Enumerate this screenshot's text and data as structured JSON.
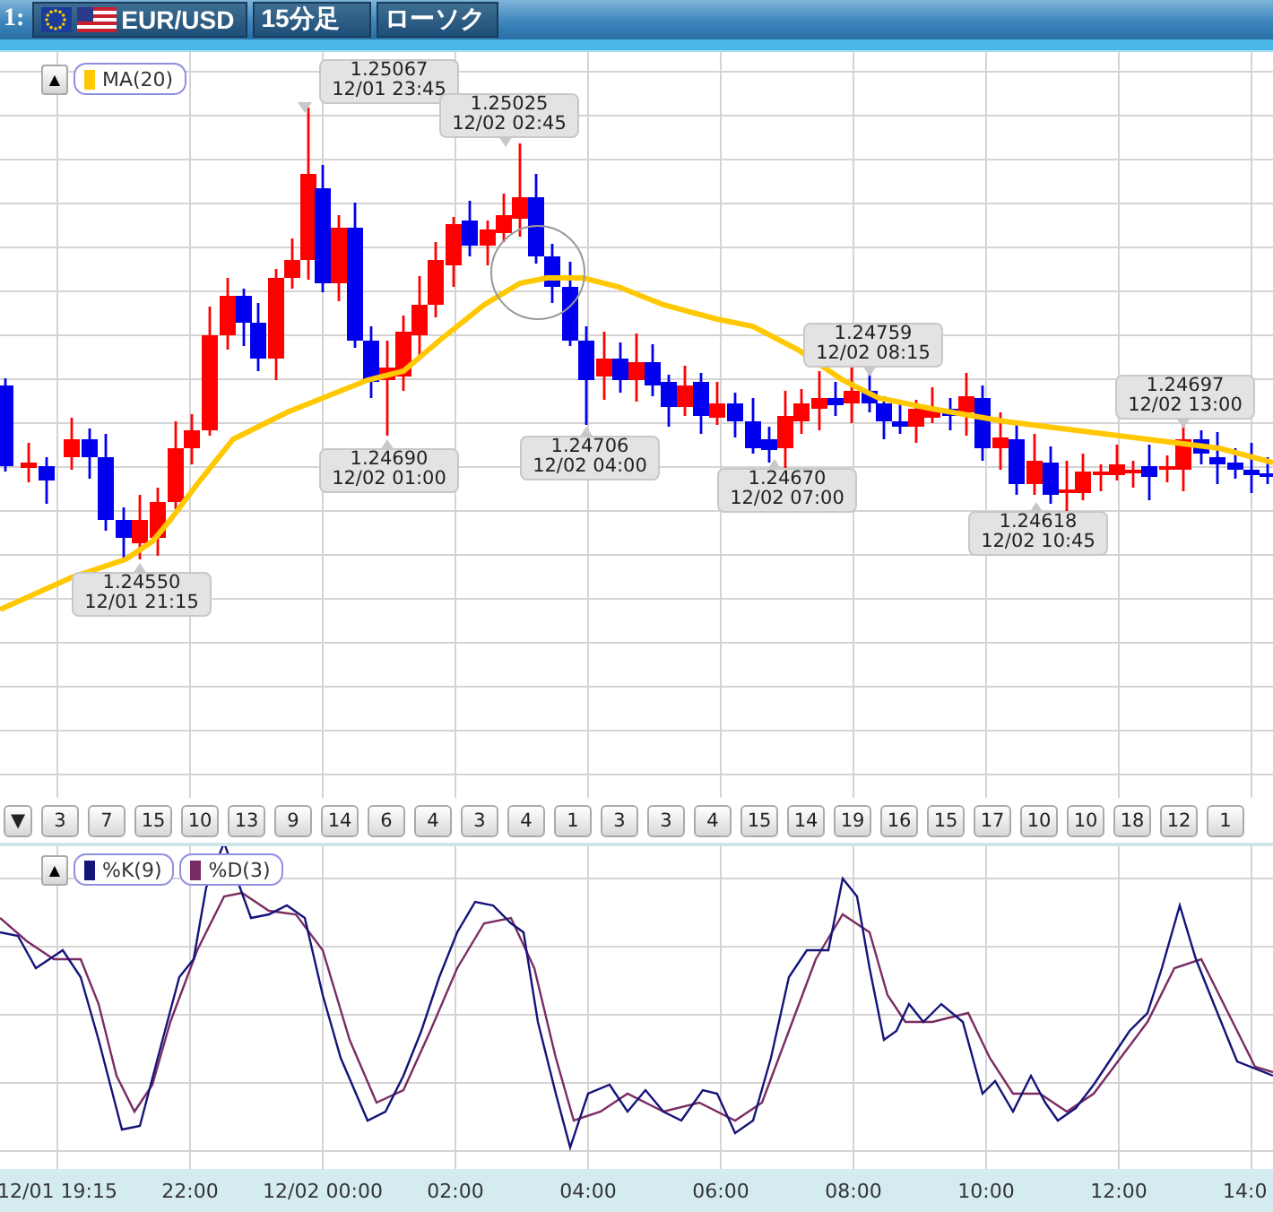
{
  "header": {
    "index": "1:",
    "tabs": [
      {
        "kind": "pair",
        "label": "EUR/USD"
      },
      {
        "kind": "text",
        "label": "15分足"
      },
      {
        "kind": "text",
        "label": "ローソク"
      }
    ]
  },
  "main_panel": {
    "legend": {
      "collapse": "▲",
      "items": [
        {
          "label": "MA(20)",
          "color": "#ffc800"
        }
      ]
    },
    "callouts": [
      {
        "kind": "high",
        "price": "1.25067",
        "time": "12/01 23:45"
      },
      {
        "kind": "high",
        "price": "1.25025",
        "time": "12/02 02:45"
      },
      {
        "kind": "low",
        "price": "1.24690",
        "time": "12/02 01:00"
      },
      {
        "kind": "low",
        "price": "1.24706",
        "time": "12/02 04:00"
      },
      {
        "kind": "low",
        "price": "1.24550",
        "time": "12/01 21:15"
      },
      {
        "kind": "high",
        "price": "1.24759",
        "time": "12/02 08:15"
      },
      {
        "kind": "low",
        "price": "1.24670",
        "time": "12/02 07:00"
      },
      {
        "kind": "low",
        "price": "1.24618",
        "time": "12/02 10:45"
      },
      {
        "kind": "high",
        "price": "1.24697",
        "time": "12/02 13:00"
      }
    ]
  },
  "count_bar": {
    "toggle": "▼",
    "counts": [
      "3",
      "7",
      "15",
      "10",
      "13",
      "9",
      "14",
      "6",
      "4",
      "3",
      "4",
      "1",
      "3",
      "3",
      "4",
      "15",
      "14",
      "19",
      "16",
      "15",
      "17",
      "10",
      "10",
      "18",
      "12",
      "1"
    ]
  },
  "oscillator_panel": {
    "legend": {
      "collapse": "▲",
      "items": [
        {
          "label": "%K(9)",
          "color": "#14147a"
        },
        {
          "label": "%D(3)",
          "color": "#7a2c62"
        }
      ]
    }
  },
  "time_axis": [
    "12/01 19:15",
    "22:00",
    "12/02 00:00",
    "02:00",
    "04:00",
    "06:00",
    "08:00",
    "10:00",
    "12:00",
    "14:0"
  ]
}
